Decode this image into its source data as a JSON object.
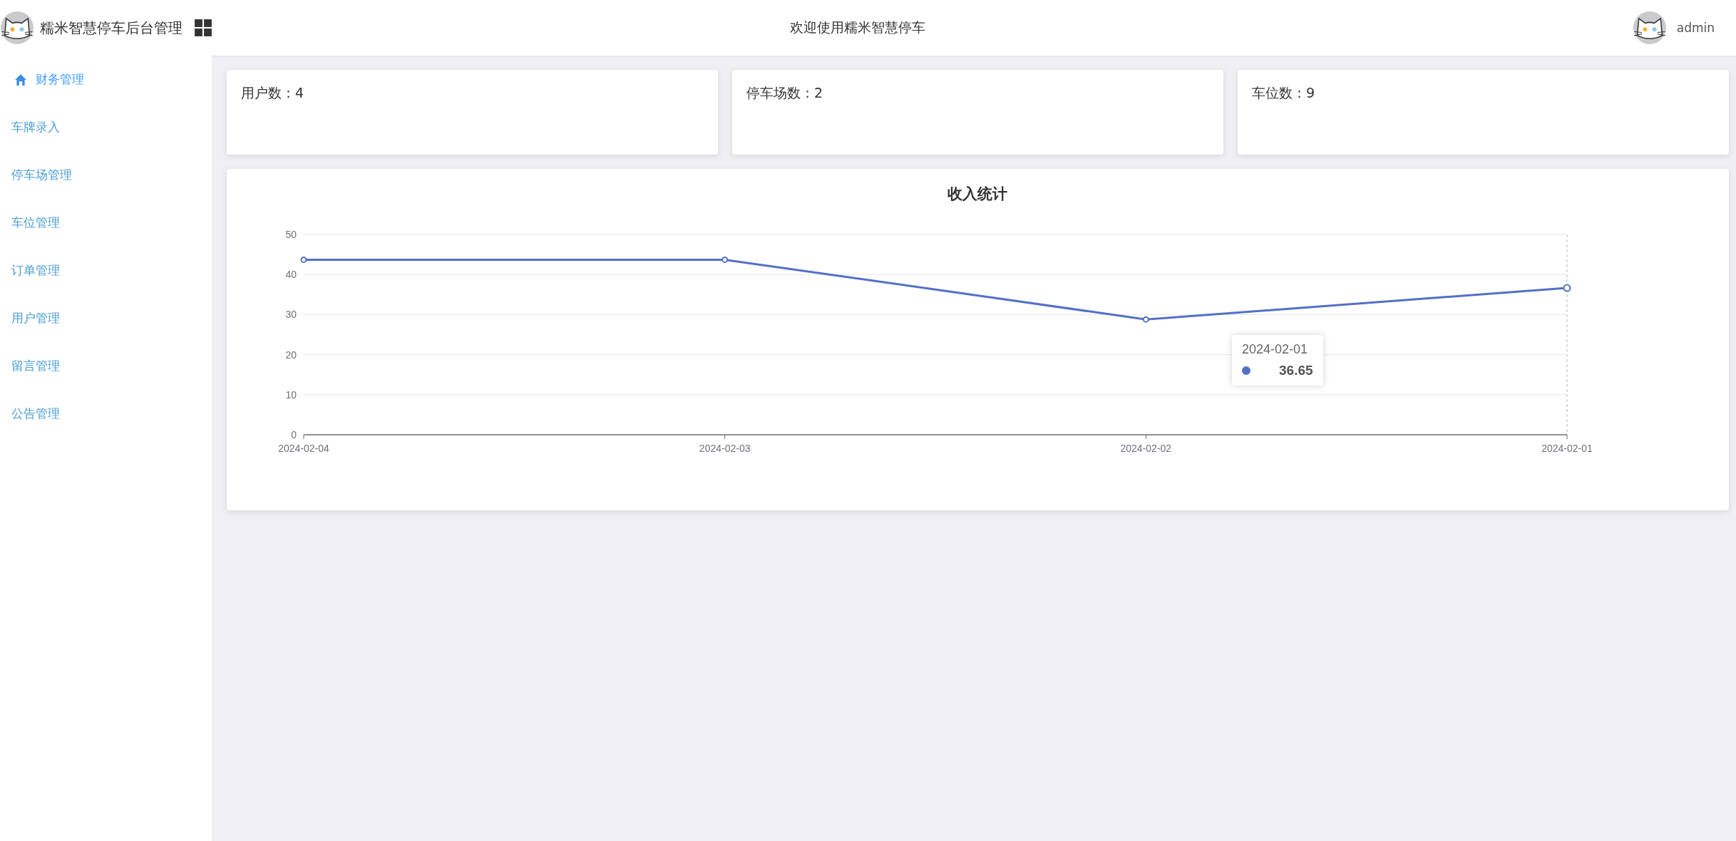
{
  "header": {
    "title": "糯米智慧停车后台管理",
    "welcome": "欢迎使用糯米智慧停车",
    "user": "admin"
  },
  "sidebar": {
    "items": [
      {
        "label": "财务管理",
        "kind": "group"
      },
      {
        "label": "车牌录入",
        "kind": "link"
      },
      {
        "label": "停车场管理",
        "kind": "link"
      },
      {
        "label": "车位管理",
        "kind": "link"
      },
      {
        "label": "订单管理",
        "kind": "link"
      },
      {
        "label": "用户管理",
        "kind": "link"
      },
      {
        "label": "留言管理",
        "kind": "link"
      },
      {
        "label": "公告管理",
        "kind": "link"
      }
    ]
  },
  "stats": [
    "用户数：4",
    "停车场数：2",
    "车位数：9"
  ],
  "chart": {
    "chart_data": {
      "type": "line",
      "title": "收入统计",
      "categories": [
        "2024-02-04",
        "2024-02-03",
        "2024-02-02",
        "2024-02-01"
      ],
      "series": [
        {
          "color": "#5470c6",
          "marker": true,
          "values": [
            43.7,
            43.7,
            28.8,
            36.65
          ]
        }
      ],
      "grid": true,
      "ylim": [
        0,
        50
      ],
      "yticks": [
        0,
        10,
        20,
        30,
        40,
        50
      ]
    },
    "tooltip": {
      "title": "2024-02-01",
      "value": "36.65"
    }
  }
}
